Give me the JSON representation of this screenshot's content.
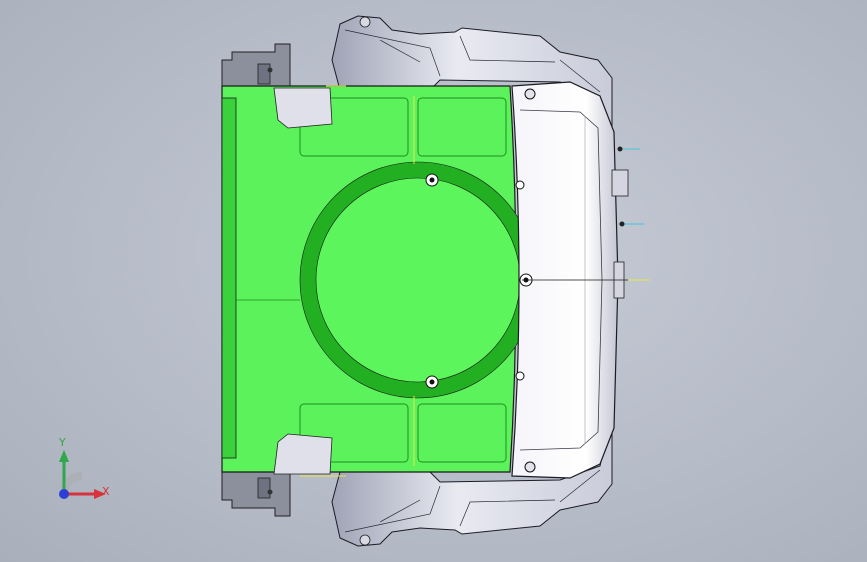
{
  "app": {
    "window_title": ""
  },
  "colors": {
    "background": "#b8bec9",
    "part_green_light": "#5bf25b",
    "part_green_dark": "#22b022",
    "outline": "#1a1a1a",
    "axis_x": "#d8323a",
    "axis_y": "#2ea84a",
    "axis_z": "#2b3fd8"
  },
  "triad": {
    "x_label": "X",
    "y_label": "Y"
  },
  "icons": [
    "view-triad-icon",
    "sketch-line-icon",
    "fastener-icon"
  ]
}
